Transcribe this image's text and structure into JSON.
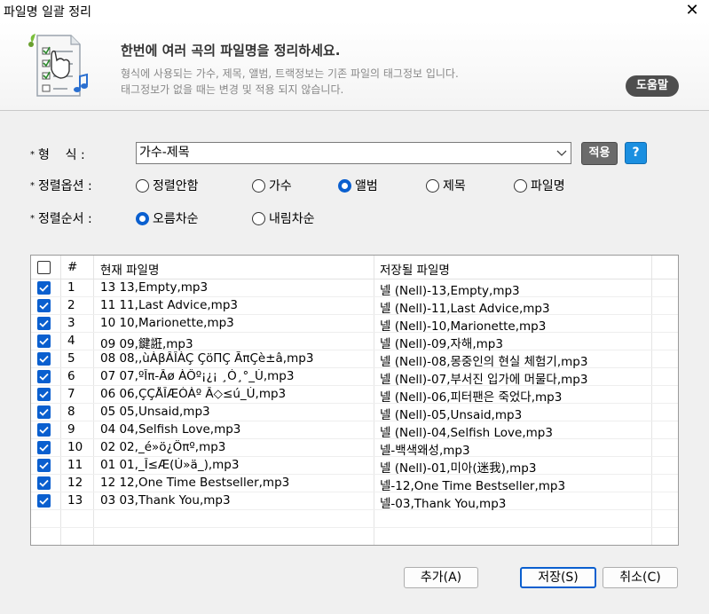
{
  "window": {
    "title": "파일명 일괄 정리",
    "close_glyph": "✕"
  },
  "banner": {
    "headline": "한번에 여러 곡의 파일명을 정리하세요.",
    "desc_line1": "형식에 사용되는 가수, 제목, 앨범, 트랙정보는 기존 파일의 태그정보 입니다.",
    "desc_line2": "태그정보가 없을 때는 변경 및 적용 되지 않습니다.",
    "help_label": "도움말",
    "icon": "file-list-music-icon"
  },
  "format": {
    "star": "*",
    "label": "형    식 :",
    "selected": "가수-제목",
    "apply_label": "적용",
    "question_label": "?"
  },
  "sort_option": {
    "star": "*",
    "label": "정렬옵션 :",
    "options": [
      "정렬안함",
      "가수",
      "앨범",
      "제목",
      "파일명"
    ],
    "selected": "앨범"
  },
  "sort_order": {
    "star": "*",
    "label": "정렬순서 :",
    "options": [
      "오름차순",
      "내림차순"
    ],
    "selected": "오름차순"
  },
  "table": {
    "columns": [
      "#",
      "현재 파일명",
      "저장될 파일명"
    ],
    "rows": [
      {
        "num": "1",
        "current": "13 13,Empty,mp3",
        "target": "넬 (Nell)-13,Empty,mp3",
        "checked": true
      },
      {
        "num": "2",
        "current": "11 11,Last Advice,mp3",
        "target": "넬 (Nell)-11,Last Advice,mp3",
        "checked": true
      },
      {
        "num": "3",
        "current": "10 10,Marionette,mp3",
        "target": "넬 (Nell)-10,Marionette,mp3",
        "checked": true
      },
      {
        "num": "4",
        "current": "09 09,鍵誑,mp3",
        "target": "넬 (Nell)-09,자해,mp3",
        "checked": true
      },
      {
        "num": "5",
        "current": "08 08,,ùÀβÂÎÀÇ ÇöΠÇ ÃπÇè±â,mp3",
        "target": "넬 (Nell)-08,몽중인의 현실 체험기,mp3",
        "checked": true
      },
      {
        "num": "6",
        "current": "07 07,ºÎπ-Âø ÀÔº¡¿¡ ¸Ó¸°_Ù,mp3",
        "target": "넬 (Nell)-07,부서진 입가에 머물다,mp3",
        "checked": true
      },
      {
        "num": "7",
        "current": "06 06,ÇÇÅÎÆÒÀº Â◇≤ú_Ù,mp3",
        "target": "넬 (Nell)-06,피터팬은 죽었다,mp3",
        "checked": true
      },
      {
        "num": "8",
        "current": "05 05,Unsaid,mp3",
        "target": "넬 (Nell)-05,Unsaid,mp3",
        "checked": true
      },
      {
        "num": "9",
        "current": "04 04,Selfish Love,mp3",
        "target": "넬 (Nell)-04,Selfish Love,mp3",
        "checked": true
      },
      {
        "num": "10",
        "current": "02 02,_é»ö¿Öπº,mp3",
        "target": "넬-백색왜성,mp3",
        "checked": true
      },
      {
        "num": "11",
        "current": "01 01,_Î≤Æ(Ú»ä_),mp3",
        "target": "넬 (Nell)-01,미아(迷我),mp3",
        "checked": true
      },
      {
        "num": "12",
        "current": "12 12,One Time Bestseller,mp3",
        "target": "넬-12,One Time Bestseller,mp3",
        "checked": true
      },
      {
        "num": "13",
        "current": "03 03,Thank You,mp3",
        "target": "넬-03,Thank You,mp3",
        "checked": true
      }
    ]
  },
  "buttons": {
    "add": "추가(A)",
    "save": "저장(S)",
    "cancel": "취소(C)"
  }
}
